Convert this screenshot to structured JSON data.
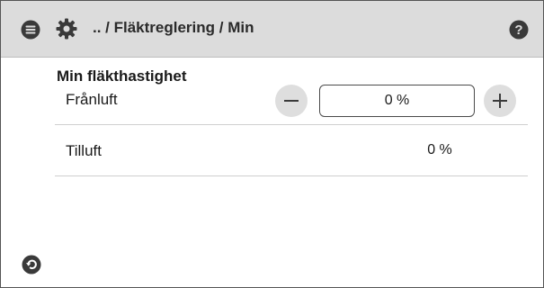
{
  "header": {
    "breadcrumb": ".. / Fläktreglering / Min",
    "menu_icon": "menu-icon",
    "settings_icon": "gear-icon",
    "help_icon": "help-icon"
  },
  "section": {
    "title": "Min fläkthastighet"
  },
  "rows": [
    {
      "label": "Frånluft",
      "value": "0 %",
      "editable": true
    },
    {
      "label": "Tilluft",
      "value": "0 %",
      "editable": false
    }
  ],
  "footer": {
    "back_icon": "back-icon"
  },
  "colors": {
    "header_bg": "#dcdcdc",
    "icon_dark": "#3a3a3a",
    "button_bg": "#dedede",
    "divider": "#cfcfcf"
  }
}
